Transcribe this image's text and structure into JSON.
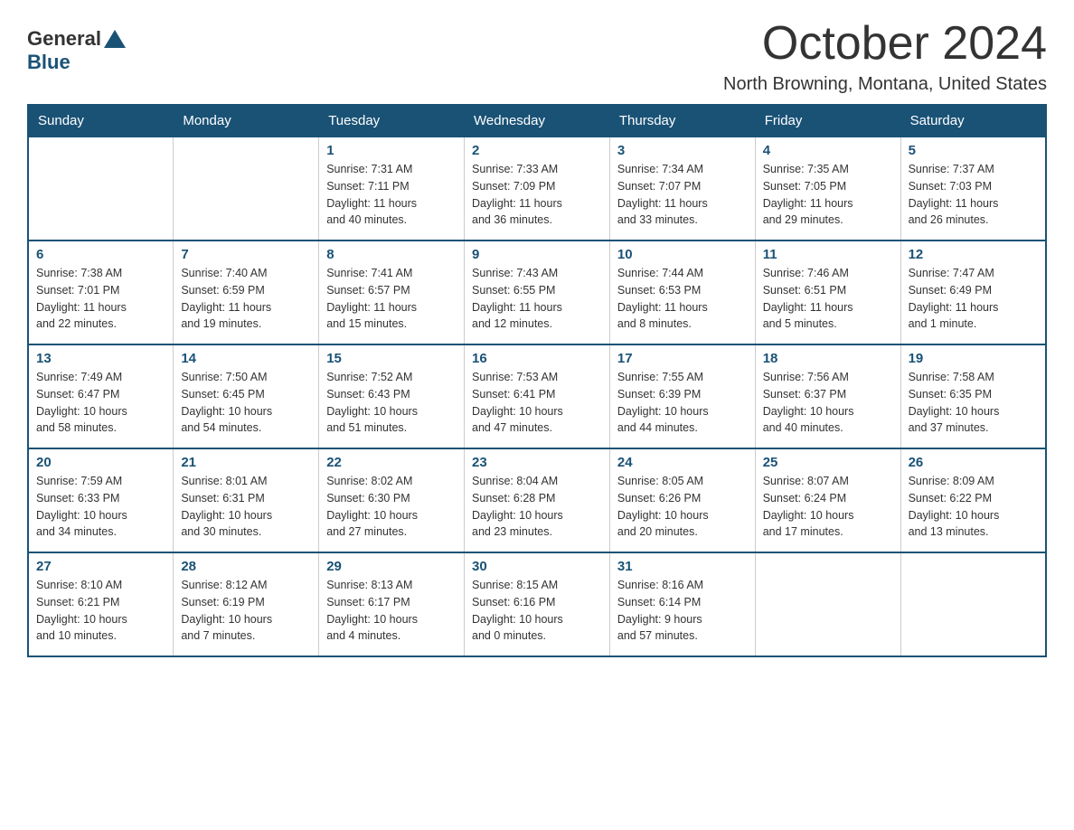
{
  "header": {
    "logo_general": "General",
    "logo_blue": "Blue",
    "title": "October 2024",
    "subtitle": "North Browning, Montana, United States"
  },
  "days_of_week": [
    "Sunday",
    "Monday",
    "Tuesday",
    "Wednesday",
    "Thursday",
    "Friday",
    "Saturday"
  ],
  "weeks": [
    [
      {
        "day": "",
        "info": ""
      },
      {
        "day": "",
        "info": ""
      },
      {
        "day": "1",
        "info": "Sunrise: 7:31 AM\nSunset: 7:11 PM\nDaylight: 11 hours\nand 40 minutes."
      },
      {
        "day": "2",
        "info": "Sunrise: 7:33 AM\nSunset: 7:09 PM\nDaylight: 11 hours\nand 36 minutes."
      },
      {
        "day": "3",
        "info": "Sunrise: 7:34 AM\nSunset: 7:07 PM\nDaylight: 11 hours\nand 33 minutes."
      },
      {
        "day": "4",
        "info": "Sunrise: 7:35 AM\nSunset: 7:05 PM\nDaylight: 11 hours\nand 29 minutes."
      },
      {
        "day": "5",
        "info": "Sunrise: 7:37 AM\nSunset: 7:03 PM\nDaylight: 11 hours\nand 26 minutes."
      }
    ],
    [
      {
        "day": "6",
        "info": "Sunrise: 7:38 AM\nSunset: 7:01 PM\nDaylight: 11 hours\nand 22 minutes."
      },
      {
        "day": "7",
        "info": "Sunrise: 7:40 AM\nSunset: 6:59 PM\nDaylight: 11 hours\nand 19 minutes."
      },
      {
        "day": "8",
        "info": "Sunrise: 7:41 AM\nSunset: 6:57 PM\nDaylight: 11 hours\nand 15 minutes."
      },
      {
        "day": "9",
        "info": "Sunrise: 7:43 AM\nSunset: 6:55 PM\nDaylight: 11 hours\nand 12 minutes."
      },
      {
        "day": "10",
        "info": "Sunrise: 7:44 AM\nSunset: 6:53 PM\nDaylight: 11 hours\nand 8 minutes."
      },
      {
        "day": "11",
        "info": "Sunrise: 7:46 AM\nSunset: 6:51 PM\nDaylight: 11 hours\nand 5 minutes."
      },
      {
        "day": "12",
        "info": "Sunrise: 7:47 AM\nSunset: 6:49 PM\nDaylight: 11 hours\nand 1 minute."
      }
    ],
    [
      {
        "day": "13",
        "info": "Sunrise: 7:49 AM\nSunset: 6:47 PM\nDaylight: 10 hours\nand 58 minutes."
      },
      {
        "day": "14",
        "info": "Sunrise: 7:50 AM\nSunset: 6:45 PM\nDaylight: 10 hours\nand 54 minutes."
      },
      {
        "day": "15",
        "info": "Sunrise: 7:52 AM\nSunset: 6:43 PM\nDaylight: 10 hours\nand 51 minutes."
      },
      {
        "day": "16",
        "info": "Sunrise: 7:53 AM\nSunset: 6:41 PM\nDaylight: 10 hours\nand 47 minutes."
      },
      {
        "day": "17",
        "info": "Sunrise: 7:55 AM\nSunset: 6:39 PM\nDaylight: 10 hours\nand 44 minutes."
      },
      {
        "day": "18",
        "info": "Sunrise: 7:56 AM\nSunset: 6:37 PM\nDaylight: 10 hours\nand 40 minutes."
      },
      {
        "day": "19",
        "info": "Sunrise: 7:58 AM\nSunset: 6:35 PM\nDaylight: 10 hours\nand 37 minutes."
      }
    ],
    [
      {
        "day": "20",
        "info": "Sunrise: 7:59 AM\nSunset: 6:33 PM\nDaylight: 10 hours\nand 34 minutes."
      },
      {
        "day": "21",
        "info": "Sunrise: 8:01 AM\nSunset: 6:31 PM\nDaylight: 10 hours\nand 30 minutes."
      },
      {
        "day": "22",
        "info": "Sunrise: 8:02 AM\nSunset: 6:30 PM\nDaylight: 10 hours\nand 27 minutes."
      },
      {
        "day": "23",
        "info": "Sunrise: 8:04 AM\nSunset: 6:28 PM\nDaylight: 10 hours\nand 23 minutes."
      },
      {
        "day": "24",
        "info": "Sunrise: 8:05 AM\nSunset: 6:26 PM\nDaylight: 10 hours\nand 20 minutes."
      },
      {
        "day": "25",
        "info": "Sunrise: 8:07 AM\nSunset: 6:24 PM\nDaylight: 10 hours\nand 17 minutes."
      },
      {
        "day": "26",
        "info": "Sunrise: 8:09 AM\nSunset: 6:22 PM\nDaylight: 10 hours\nand 13 minutes."
      }
    ],
    [
      {
        "day": "27",
        "info": "Sunrise: 8:10 AM\nSunset: 6:21 PM\nDaylight: 10 hours\nand 10 minutes."
      },
      {
        "day": "28",
        "info": "Sunrise: 8:12 AM\nSunset: 6:19 PM\nDaylight: 10 hours\nand 7 minutes."
      },
      {
        "day": "29",
        "info": "Sunrise: 8:13 AM\nSunset: 6:17 PM\nDaylight: 10 hours\nand 4 minutes."
      },
      {
        "day": "30",
        "info": "Sunrise: 8:15 AM\nSunset: 6:16 PM\nDaylight: 10 hours\nand 0 minutes."
      },
      {
        "day": "31",
        "info": "Sunrise: 8:16 AM\nSunset: 6:14 PM\nDaylight: 9 hours\nand 57 minutes."
      },
      {
        "day": "",
        "info": ""
      },
      {
        "day": "",
        "info": ""
      }
    ]
  ]
}
